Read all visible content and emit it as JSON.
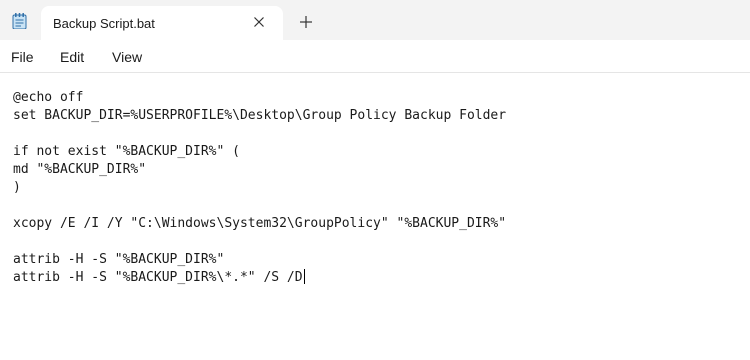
{
  "window": {
    "tab_title": "Backup Script.bat",
    "app_icon": "notepad-icon",
    "close_icon": "close-icon",
    "new_tab_icon": "plus-icon"
  },
  "menu": {
    "file": "File",
    "edit": "Edit",
    "view": "View"
  },
  "editor": {
    "lines": [
      "@echo off",
      "set BACKUP_DIR=%USERPROFILE%\\Desktop\\Group Policy Backup Folder",
      "",
      "if not exist \"%BACKUP_DIR%\" (",
      "md \"%BACKUP_DIR%\"",
      ")",
      "",
      "xcopy /E /I /Y \"C:\\Windows\\System32\\GroupPolicy\" \"%BACKUP_DIR%\"",
      "",
      "attrib -H -S \"%BACKUP_DIR%\"",
      "attrib -H -S \"%BACKUP_DIR%\\*.*\" /S /D"
    ]
  },
  "colors": {
    "tabbar_bg": "#f3f3f3",
    "editor_bg": "#ffffff",
    "text": "#1a1a1a"
  }
}
